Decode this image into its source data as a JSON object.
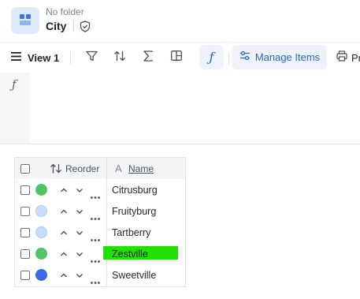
{
  "header": {
    "folder": "No folder",
    "title": "City"
  },
  "toolbar": {
    "view_label": "View 1",
    "manage_label": "Manage Items",
    "print_label": "Pr"
  },
  "table": {
    "columns": {
      "reorder": "Reorder",
      "name": "Name"
    },
    "rows": [
      {
        "name": "Citrusburg",
        "color": "#54c266"
      },
      {
        "name": "Fruityburg",
        "color": "#c6ddf5"
      },
      {
        "name": "Tartberry",
        "color": "#c6ddf5"
      },
      {
        "name": "Zestville",
        "color": "#54c266",
        "highlight": "#22e000"
      },
      {
        "name": "Sweetville",
        "color": "#3a68e6"
      }
    ]
  },
  "colors": {
    "accent": "#2865c7",
    "accent_bg": "#eef3fb"
  }
}
